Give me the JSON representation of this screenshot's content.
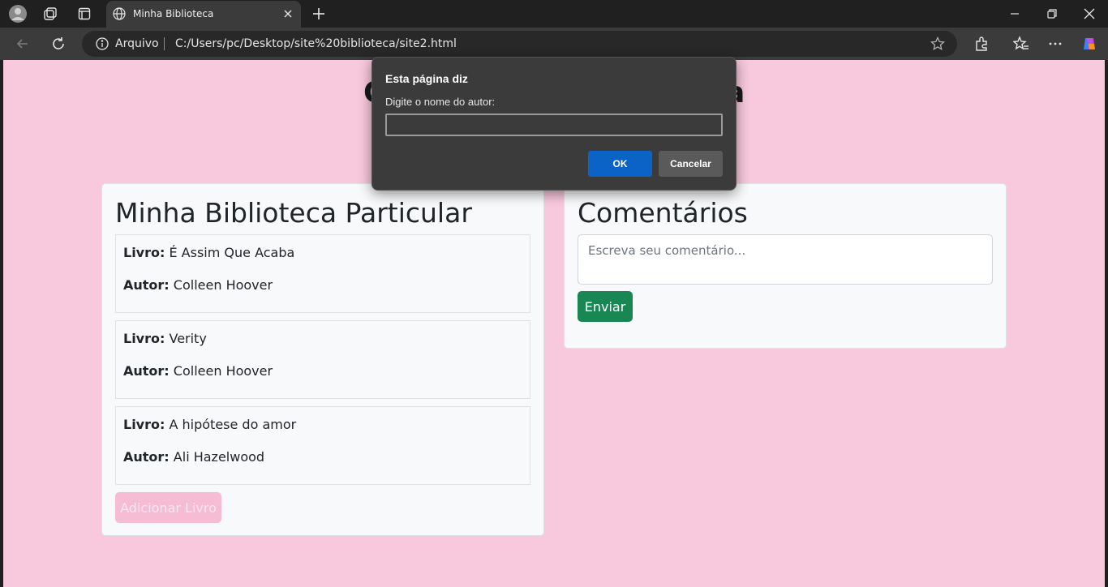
{
  "browser": {
    "tab_title": "Minha Biblioteca",
    "address_label": "Arquivo",
    "url": "C:/Users/pc/Desktop/site%20biblioteca/site2.html"
  },
  "page": {
    "heading_partial_left": "C",
    "heading_partial_right": "a"
  },
  "library": {
    "title": "Minha Biblioteca Particular",
    "book_label": "Livro:",
    "author_label": "Autor:",
    "books": [
      {
        "title": "É Assim Que Acaba",
        "author": "Colleen Hoover"
      },
      {
        "title": "Verity",
        "author": "Colleen Hoover"
      },
      {
        "title": "A hipótese do amor",
        "author": "Ali Hazelwood"
      }
    ],
    "add_button": "Adicionar Livro"
  },
  "comments": {
    "title": "Comentários",
    "placeholder": "Escreva seu comentário...",
    "send_button": "Enviar"
  },
  "dialog": {
    "title": "Esta página diz",
    "message": "Digite o nome do autor:",
    "input_value": "",
    "ok": "OK",
    "cancel": "Cancelar"
  },
  "colors": {
    "page_bg": "#f8c8dc",
    "send_button": "#198754",
    "add_button": "#f5bcd3",
    "dialog_ok": "#0b63c5"
  }
}
